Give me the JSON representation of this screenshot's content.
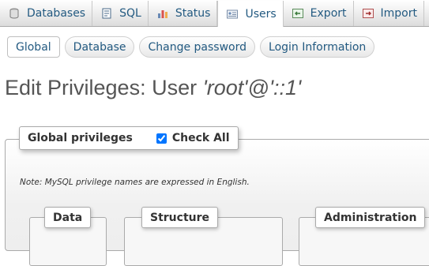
{
  "topnav": {
    "tabs": [
      {
        "label": "Databases",
        "icon": "database-icon",
        "active": false
      },
      {
        "label": "SQL",
        "icon": "sql-icon",
        "active": false
      },
      {
        "label": "Status",
        "icon": "status-chart-icon",
        "active": false
      },
      {
        "label": "Users",
        "icon": "users-icon",
        "active": true
      },
      {
        "label": "Export",
        "icon": "export-icon",
        "active": false
      },
      {
        "label": "Import",
        "icon": "import-icon",
        "active": false
      }
    ]
  },
  "subnav": {
    "tabs": [
      {
        "label": "Global",
        "active": true
      },
      {
        "label": "Database",
        "active": false
      },
      {
        "label": "Change password",
        "active": false
      },
      {
        "label": "Login Information",
        "active": false
      }
    ]
  },
  "page": {
    "title_prefix": "Edit Privileges: User ",
    "title_user": "'root'@'::1'"
  },
  "global_privileges": {
    "legend": "Global privileges",
    "check_all_label": "Check All",
    "check_all_checked": true,
    "note": "Note: MySQL privilege names are expressed in English.",
    "groups": [
      "Data",
      "Structure",
      "Administration"
    ]
  },
  "colors": {
    "link": "#235a81",
    "title": "#555555",
    "border": "#aaaaaa"
  }
}
